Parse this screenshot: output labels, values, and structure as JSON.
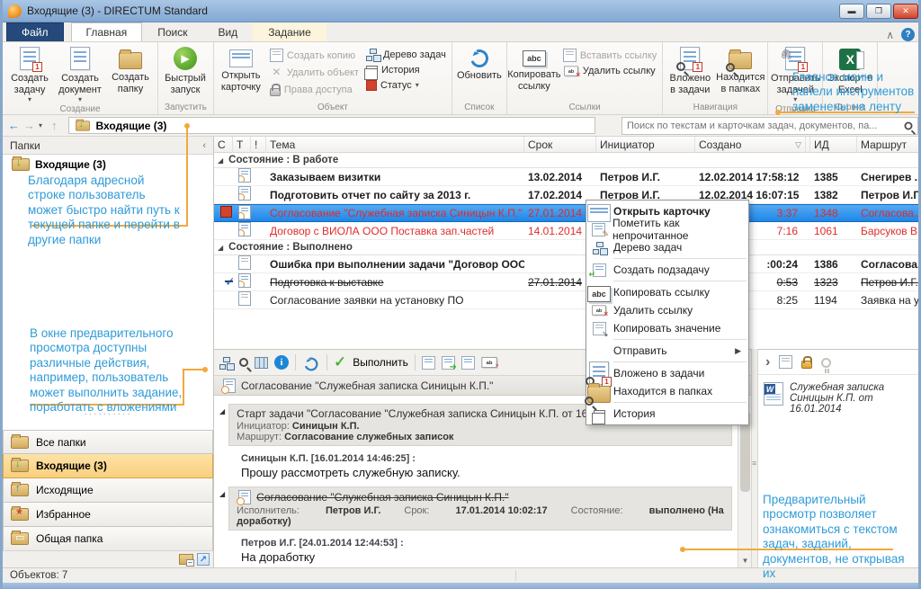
{
  "window": {
    "title": "Входящие (3) - DIRECTUM Standard",
    "status": "Объектов: 7"
  },
  "tabs": [
    {
      "label": "Файл",
      "kind": "file"
    },
    {
      "label": "Главная",
      "kind": "active"
    },
    {
      "label": "Поиск",
      "kind": "normal"
    },
    {
      "label": "Вид",
      "kind": "normal"
    },
    {
      "label": "Задание",
      "kind": "contextual"
    }
  ],
  "ribbon": {
    "groups": [
      {
        "label": "Создание",
        "items": [
          {
            "kind": "big",
            "label": "Создать задачу",
            "icon": "create-task",
            "arrow": true
          },
          {
            "kind": "big",
            "label": "Создать документ",
            "icon": "create-document",
            "arrow": true
          },
          {
            "kind": "big",
            "label": "Создать папку",
            "icon": "create-folder"
          }
        ]
      },
      {
        "label": "Запустить",
        "items": [
          {
            "kind": "big",
            "label": "Быстрый запуск",
            "icon": "quick-launch"
          }
        ]
      },
      {
        "label": "Объект",
        "items": [
          {
            "kind": "big",
            "label": "Открыть карточку",
            "icon": "open-card"
          },
          {
            "kind": "stack",
            "buttons": [
              {
                "label": "Создать копию",
                "icon": "create-copy",
                "disabled": true
              },
              {
                "label": "Удалить объект",
                "icon": "delete-object",
                "disabled": true
              },
              {
                "label": "Права доступа",
                "icon": "access-rights",
                "disabled": true
              }
            ]
          },
          {
            "kind": "stack",
            "buttons": [
              {
                "label": "Дерево задач",
                "icon": "task-tree"
              },
              {
                "label": "История",
                "icon": "history"
              },
              {
                "label": "Статус",
                "icon": "status",
                "arrow": true
              }
            ]
          }
        ]
      },
      {
        "label": "Список",
        "items": [
          {
            "kind": "big",
            "label": "Обновить",
            "icon": "refresh"
          }
        ]
      },
      {
        "label": "Ссылки",
        "items": [
          {
            "kind": "big",
            "label": "Копировать ссылку",
            "icon": "copy-link"
          },
          {
            "kind": "stack",
            "buttons": [
              {
                "label": "Вставить ссылку",
                "icon": "paste-link",
                "disabled": true
              },
              {
                "label": "Удалить ссылку",
                "icon": "delete-link"
              }
            ]
          }
        ]
      },
      {
        "label": "Навигация",
        "items": [
          {
            "kind": "big",
            "label": "Вложено в задачи",
            "icon": "attached-in-tasks"
          },
          {
            "kind": "big",
            "label": "Находится в папках",
            "icon": "located-in-folders"
          }
        ]
      },
      {
        "label": "Отправка",
        "items": [
          {
            "kind": "big",
            "label": "Отправить задачей",
            "icon": "send-as-task",
            "arrow": true
          }
        ]
      },
      {
        "label": "Сервис",
        "items": [
          {
            "kind": "big",
            "label": "Экспорт в Excel",
            "icon": "export-excel"
          }
        ]
      }
    ]
  },
  "callouts": {
    "ribbon": "Главное меню и панели инструментов заменены на ленту",
    "sidebar_top": "Благодаря адресной строке пользователь может быстро найти путь к текущей папке и перейти в другие папки",
    "sidebar_bottom": "В окне предварительного просмотра доступны различные действия, например, пользователь может выполнить задание, поработать с вложениями",
    "preview": "Предварительный просмотр позволяет ознакомиться с текстом задач, заданий, документов, не открывая их"
  },
  "address_bar": {
    "breadcrumb": "Входящие (3)",
    "search_placeholder": "Поиск по текстам и карточкам задач, документов, па..."
  },
  "sidebar": {
    "header": "Папки",
    "tree_item": "Входящие (3)",
    "folders": [
      {
        "label": "Все папки",
        "icon": "all-folders"
      },
      {
        "label": "Входящие (3)",
        "icon": "inbox-folder",
        "active": true
      },
      {
        "label": "Исходящие",
        "icon": "outbox-folder"
      },
      {
        "label": "Избранное",
        "icon": "favorites-folder"
      },
      {
        "label": "Общая папка",
        "icon": "shared-folder"
      }
    ]
  },
  "task_list": {
    "columns": [
      "С",
      "Т",
      "!",
      "Тема",
      "Срок",
      "Инициатор",
      "Создано",
      "ИД",
      "Маршрут"
    ],
    "sorted_column": "Создано",
    "groups": [
      {
        "label": "Состояние : В работе",
        "rows": [
          {
            "subject": "Заказываем визитки",
            "due": "13.02.2014",
            "initiator": "Петров И.Г.",
            "created": "12.02.2014 17:58:12",
            "id": "1385",
            "route": "Снегирев ...",
            "bold": true,
            "icon": "task"
          },
          {
            "subject": "Подготовить отчет по сайту за 2013 г.",
            "due": "17.02.2014",
            "initiator": "Петров И.Г.",
            "created": "12.02.2014 16:07:15",
            "id": "1382",
            "route": "Петров И.Г.",
            "bold": true,
            "icon": "task"
          },
          {
            "subject": "Согласование \"Служебная записка Синицын К.П.\"",
            "due": "27.01.2014 17:0",
            "initiator": "",
            "created": "3:37",
            "id": "1348",
            "route": "Согласова...",
            "overdue": true,
            "selected": true,
            "marker": true,
            "icon": "task"
          },
          {
            "subject": "Договор с ВИОЛА ООО Поставка зап.частей",
            "due": "14.01.2014",
            "initiator": "",
            "created": "7:16",
            "id": "1061",
            "route": "Барсуков В....",
            "overdue": true,
            "icon": "task"
          }
        ]
      },
      {
        "label": "Состояние : Выполнено",
        "rows": [
          {
            "subject": "Ошибка при выполнении задачи \"Договор ООО \"Плане...",
            "due": "",
            "initiator": "",
            "created": ":00:24",
            "id": "1386",
            "route": "Согласова...",
            "bold": true,
            "icon": "note"
          },
          {
            "subject": "Подготовка к выставке",
            "due": "27.01.2014",
            "initiator": "",
            "created": "0:53",
            "id": "1323",
            "route": "Петров И.Г.",
            "strike": true,
            "check": true,
            "icon": "task"
          },
          {
            "subject": "Согласование заявки на установку ПО",
            "due": "",
            "initiator": "",
            "created": "8:25",
            "id": "1194",
            "route": "Заявка на у...",
            "icon": "note"
          }
        ]
      }
    ]
  },
  "context_menu": {
    "items": [
      {
        "label": "Открыть карточку",
        "icon": "open-card",
        "bold": true
      },
      {
        "label": "Пометить как непрочитанное",
        "icon": "mark-unread"
      },
      {
        "label": "Дерево задач",
        "icon": "task-tree"
      },
      {
        "sep": true
      },
      {
        "label": "Создать подзадачу",
        "icon": "create-subtask"
      },
      {
        "sep": true
      },
      {
        "label": "Копировать ссылку",
        "icon": "copy-link"
      },
      {
        "label": "Удалить ссылку",
        "icon": "delete-link"
      },
      {
        "label": "Копировать значение",
        "icon": "copy-value"
      },
      {
        "sep": true
      },
      {
        "label": "Отправить",
        "submenu": true
      },
      {
        "sep": true
      },
      {
        "label": "Вложено в задачи",
        "icon": "attached-in-tasks"
      },
      {
        "label": "Находится в папках",
        "icon": "located-in-folders"
      },
      {
        "sep": true
      },
      {
        "label": "История",
        "icon": "history"
      }
    ]
  },
  "preview": {
    "execute_label": "Выполнить",
    "header": {
      "title": "Согласование \"Служебная записка Синицын К.П.\"",
      "state_label": "Состояние:"
    },
    "blocks": [
      {
        "title": "Старт задачи \"Согласование \"Служебная записка Синицын К.П. от 16.01.2014\"\"",
        "meta": [
          {
            "label": "Инициатор:",
            "value": "Синицын К.П."
          },
          {
            "label": "Маршрут:",
            "value": "Согласование служебных записок"
          }
        ],
        "meta_layout": "lines",
        "author": "Синицын К.П. [16.01.2014 14:46:25] :",
        "message": "Прошу рассмотреть служебную записку."
      },
      {
        "title": "Согласование \"Служебная записка Синицын К.П.\"",
        "strike": true,
        "icon": "task",
        "meta": [
          {
            "label": "Исполнитель:",
            "value": "Петров И.Г."
          },
          {
            "label": "Срок:",
            "value": "17.01.2014 10:02:17"
          },
          {
            "label": "Состояние:",
            "value": "выполнено (На доработку)"
          }
        ],
        "meta_layout": "inline",
        "author": "Петров И.Г. [24.01.2014 12:44:53] :",
        "message": "На доработку"
      }
    ]
  },
  "attachments": {
    "items": [
      {
        "title": "Служебная записка Синицын К.П.  от 16.01.2014",
        "icon": "word-document"
      }
    ]
  }
}
